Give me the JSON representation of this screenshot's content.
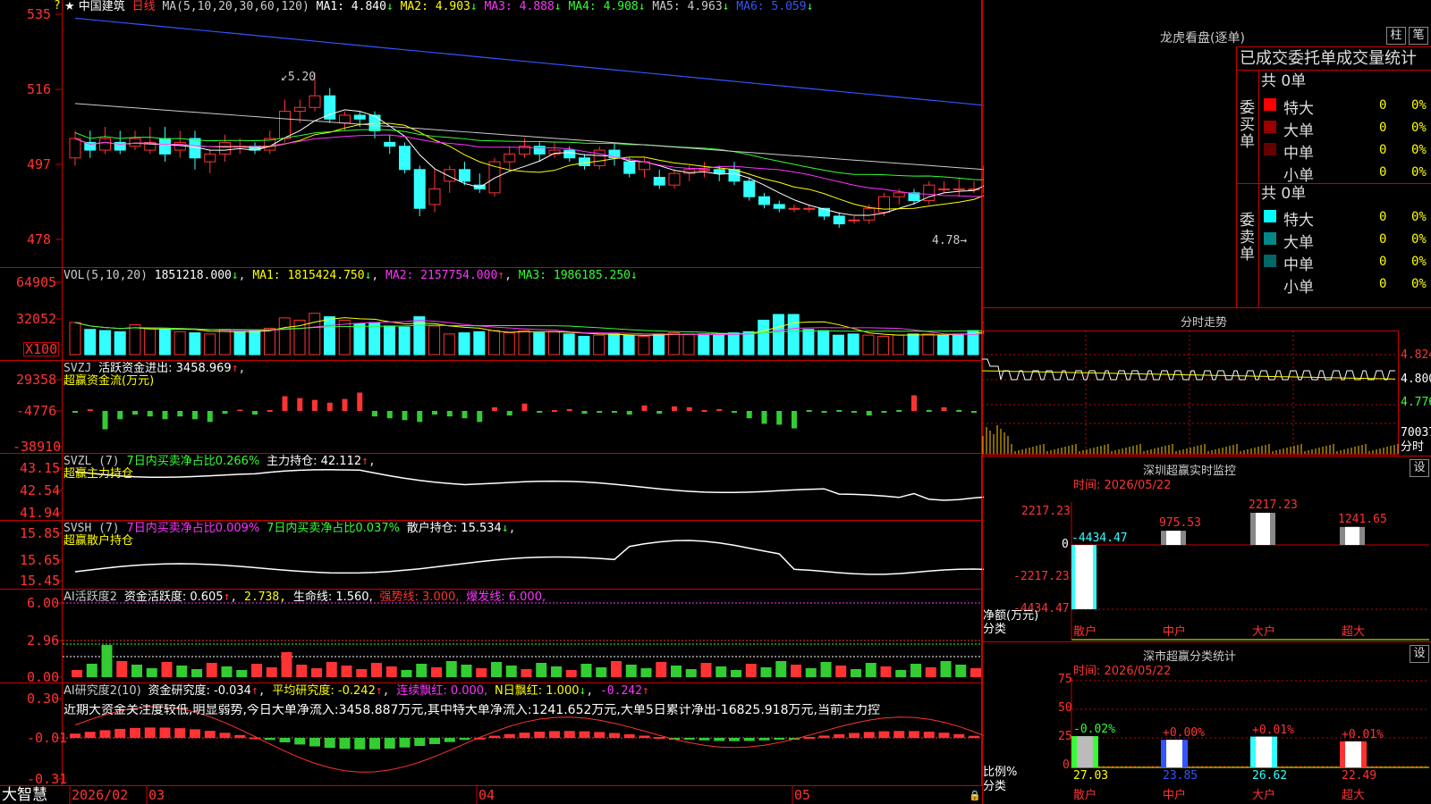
{
  "stock": {
    "title": "★ 中国建筑",
    "period": "日线",
    "ma_header": "MA(5,10,20,30,60,120)",
    "ma_values": [
      {
        "label": "MA1: 4.840",
        "arrow": "↓",
        "color": "#ffffff"
      },
      {
        "label": "MA2: 4.903",
        "arrow": "↓",
        "color": "#ffff00"
      },
      {
        "label": "MA3: 4.888",
        "arrow": "↓",
        "color": "#ff33ff"
      },
      {
        "label": "MA4: 4.908",
        "arrow": "↓",
        "color": "#33ff33"
      },
      {
        "label": "MA5: 4.963",
        "arrow": "↓",
        "color": "#cccccc"
      },
      {
        "label": "MA6: 5.059",
        "arrow": "↓",
        "color": "#3355ff"
      }
    ],
    "y_axis": [
      "535",
      "516",
      "497",
      "478"
    ],
    "high_label": "5.20",
    "low_label": "4.78",
    "question_mark": "?"
  },
  "vol": {
    "header": "VOL(5,10,20)",
    "value": "1851218.000",
    "ma1": "MA1: 1815424.750",
    "ma2": "MA2: 2157754.000",
    "ma3": "MA3: 1986185.250",
    "y_axis": [
      "64905",
      "32052",
      "X100"
    ]
  },
  "svzj": {
    "header": "SVZJ",
    "label": "活跃资金进出: 3458.969",
    "sub": "超赢资金流(万元)",
    "y_axis": [
      "29358",
      "-4776",
      "-38910"
    ]
  },
  "svzl": {
    "header": "SVZL (7)",
    "ratio": "7日内买卖净占比0.266%",
    "hold": "主力持仓: 42.112",
    "sub": "超赢主力持仓",
    "y_axis": [
      "43.15",
      "42.54",
      "41.94"
    ]
  },
  "svsh": {
    "header": "SVSH (7)",
    "ratio1": "7日内买卖净占比0.009%",
    "ratio2": "7日内买卖净占比0.037%",
    "hold": "散户持仓: 15.534",
    "sub": "超赢散户持仓",
    "y_axis": [
      "15.85",
      "15.65",
      "15.45"
    ]
  },
  "ai_active": {
    "header": "AI活跃度2",
    "label": "资金活跃度: 0.605",
    "v2": "2.738,",
    "life": "生命线: 1.560,",
    "strong": "强势线: 3.000,",
    "burst": "爆发线: 6.000,",
    "y_axis": [
      "6.00",
      "2.96",
      "0.00"
    ]
  },
  "ai_research": {
    "header": "AI研究度2(10)",
    "label": "资金研究度: -0.034",
    "avg": "平均研究度: -0.242",
    "cont": "连续飘红: 0.000,",
    "n": "N日飘红: 1.000",
    "last": "-0.242",
    "note": "近期大资金关注度较低,明显弱势,今日大单净流入:3458.887万元,其中特大单净流入:1241.652万元,大单5日累计净出-16825.918万元,当前主力控",
    "y_axis": [
      "0.30",
      "-0.01",
      "-0.31"
    ]
  },
  "bottom_axis": {
    "brand": "大智慧",
    "labels": [
      "2026/02",
      "03",
      "04",
      "05"
    ]
  },
  "longhu": {
    "title": "龙虎看盘(逐单)",
    "btn1": "柱",
    "btn2": "笔",
    "subtitle": "已成交委托单成交量统计",
    "buy_total": "共 0单",
    "buy_label": "委买单",
    "sell_total": "共 0单",
    "sell_label": "委卖单",
    "buy_rows": [
      {
        "label": "特大",
        "num": "0",
        "pct": "0%",
        "color": "#ff0000"
      },
      {
        "label": "大单",
        "num": "0",
        "pct": "0%",
        "color": "#990000"
      },
      {
        "label": "中单",
        "num": "0",
        "pct": "0%",
        "color": "#660000"
      },
      {
        "label": "小单",
        "num": "0",
        "pct": "0%",
        "color": "#000000"
      }
    ],
    "sell_rows": [
      {
        "label": "特大",
        "num": "0",
        "pct": "0%",
        "color": "#00ffff"
      },
      {
        "label": "大单",
        "num": "0",
        "pct": "0%",
        "color": "#008888"
      },
      {
        "label": "中单",
        "num": "0",
        "pct": "0%",
        "color": "#006666"
      },
      {
        "label": "小单",
        "num": "0",
        "pct": "0%",
        "color": "#000000"
      }
    ]
  },
  "intraday": {
    "title": "分时走势",
    "y_axis": [
      "4.824",
      "4.800",
      "4.776"
    ],
    "vol_label": "70037",
    "sub": "分时"
  },
  "monitor": {
    "title": "深圳超赢实时监控",
    "btn": "设",
    "time": "时间: 2026/05/22",
    "y_axis": [
      "2217.23",
      "0",
      "-2217.23",
      "-4434.47"
    ],
    "left_label1": "净额(万元)",
    "left_label2": "分类",
    "bars": [
      {
        "cat": "散户",
        "value": "-4434.47"
      },
      {
        "cat": "中户",
        "value": "975.53"
      },
      {
        "cat": "大户",
        "value": "2217.23"
      },
      {
        "cat": "超大",
        "value": "1241.65"
      }
    ]
  },
  "classify": {
    "title": "深市超赢分类统计",
    "btn": "设",
    "time": "时间: 2026/05/22",
    "y_axis": [
      "75",
      "50",
      "25",
      "0"
    ],
    "left_label1": "比例%",
    "left_label2": "分类",
    "bars": [
      {
        "cat": "散户",
        "pct": "27.03",
        "chg": "-0.02%",
        "color": "#33ff33"
      },
      {
        "cat": "中户",
        "pct": "23.85",
        "chg": "+0.00%",
        "color": "#3355ff"
      },
      {
        "cat": "大户",
        "pct": "26.62",
        "chg": "+0.01%",
        "color": "#33ffff"
      },
      {
        "cat": "超大",
        "pct": "22.49",
        "chg": "+0.01%",
        "color": "#ff3333"
      }
    ]
  },
  "chart_data": [
    {
      "type": "candlestick",
      "title": "中国建筑 日线",
      "ylim": [
        4.75,
        5.38
      ],
      "candles": [
        [
          4.98,
          5.03,
          5.05,
          4.96
        ],
        [
          5.02,
          5.0,
          5.05,
          4.98
        ],
        [
          5.0,
          5.03,
          5.06,
          4.99
        ],
        [
          5.02,
          5.0,
          5.05,
          4.99
        ],
        [
          5.01,
          5.03,
          5.05,
          5.0
        ],
        [
          5.0,
          5.02,
          5.06,
          4.99
        ],
        [
          5.03,
          4.99,
          5.06,
          4.97
        ],
        [
          5.0,
          5.02,
          5.05,
          4.98
        ],
        [
          5.03,
          4.98,
          5.05,
          4.95
        ],
        [
          4.97,
          4.99,
          5.0,
          4.94
        ],
        [
          4.99,
          5.02,
          5.04,
          4.97
        ],
        [
          5.01,
          5.01,
          5.03,
          4.99
        ],
        [
          5.01,
          5.0,
          5.02,
          4.99
        ],
        [
          5.0,
          5.03,
          5.05,
          4.99
        ],
        [
          5.03,
          5.1,
          5.13,
          5.02
        ],
        [
          5.1,
          5.11,
          5.13,
          5.07
        ],
        [
          5.11,
          5.14,
          5.2,
          5.1
        ],
        [
          5.14,
          5.08,
          5.16,
          5.07
        ],
        [
          5.07,
          5.09,
          5.1,
          5.05
        ],
        [
          5.09,
          5.08,
          5.1,
          5.06
        ],
        [
          5.09,
          5.05,
          5.1,
          5.03
        ],
        [
          5.02,
          5.01,
          5.04,
          4.99
        ],
        [
          5.01,
          4.95,
          5.02,
          4.94
        ],
        [
          4.95,
          4.85,
          4.96,
          4.83
        ],
        [
          4.86,
          4.9,
          4.95,
          4.84
        ],
        [
          4.92,
          4.95,
          4.96,
          4.89
        ],
        [
          4.95,
          4.92,
          4.97,
          4.91
        ],
        [
          4.91,
          4.9,
          4.94,
          4.89
        ],
        [
          4.89,
          4.97,
          4.98,
          4.88
        ],
        [
          4.97,
          4.99,
          5.01,
          4.95
        ],
        [
          4.99,
          5.01,
          5.03,
          4.98
        ],
        [
          5.01,
          4.99,
          5.02,
          4.97
        ],
        [
          4.99,
          5.0,
          5.02,
          4.98
        ],
        [
          5.0,
          4.98,
          5.01,
          4.97
        ],
        [
          4.98,
          4.96,
          4.99,
          4.95
        ],
        [
          4.96,
          5.0,
          5.01,
          4.95
        ],
        [
          5.0,
          4.98,
          5.02,
          4.96
        ],
        [
          4.97,
          4.94,
          4.98,
          4.93
        ],
        [
          4.95,
          4.97,
          4.98,
          4.93
        ],
        [
          4.93,
          4.91,
          4.95,
          4.9
        ],
        [
          4.91,
          4.94,
          4.95,
          4.9
        ],
        [
          4.94,
          4.95,
          4.96,
          4.92
        ],
        [
          4.95,
          4.95,
          4.97,
          4.93
        ],
        [
          4.95,
          4.94,
          4.96,
          4.92
        ],
        [
          4.95,
          4.92,
          4.97,
          4.91
        ],
        [
          4.92,
          4.88,
          4.93,
          4.87
        ],
        [
          4.88,
          4.86,
          4.89,
          4.85
        ],
        [
          4.86,
          4.85,
          4.87,
          4.84
        ],
        [
          4.85,
          4.85,
          4.86,
          4.84
        ],
        [
          4.85,
          4.85,
          4.86,
          4.84
        ],
        [
          4.85,
          4.83,
          4.85,
          4.82
        ],
        [
          4.83,
          4.81,
          4.84,
          4.8
        ],
        [
          4.82,
          4.82,
          4.83,
          4.81
        ],
        [
          4.82,
          4.85,
          4.86,
          4.81
        ],
        [
          4.84,
          4.88,
          4.89,
          4.83
        ],
        [
          4.88,
          4.89,
          4.9,
          4.86
        ],
        [
          4.89,
          4.87,
          4.9,
          4.86
        ],
        [
          4.87,
          4.91,
          4.92,
          4.86
        ],
        [
          4.9,
          4.9,
          4.92,
          4.89
        ],
        [
          4.9,
          4.9,
          4.93,
          4.88
        ],
        [
          4.9,
          4.9,
          4.92,
          4.89
        ],
        [
          4.89,
          4.96,
          4.97,
          4.88
        ],
        [
          4.96,
          4.92,
          5.02,
          4.91
        ],
        [
          4.97,
          4.99,
          5.0,
          4.94
        ],
        [
          4.97,
          4.94,
          4.99,
          4.93
        ],
        [
          4.94,
          4.93,
          4.96,
          4.92
        ],
        [
          4.95,
          4.93,
          4.96,
          4.91
        ],
        [
          4.93,
          4.89,
          4.95,
          4.88
        ],
        [
          4.9,
          4.87,
          4.92,
          4.86
        ],
        [
          4.87,
          4.82,
          4.88,
          4.81
        ],
        [
          4.82,
          4.8,
          4.83,
          4.79
        ],
        [
          4.8,
          4.78,
          4.81,
          4.78
        ]
      ],
      "ma_series": [
        {
          "name": "MA1",
          "color": "#ffffff"
        },
        {
          "name": "MA2",
          "color": "#ffff00"
        },
        {
          "name": "MA3",
          "color": "#ff33ff"
        },
        {
          "name": "MA4",
          "color": "#33ff33"
        },
        {
          "name": "MA5",
          "color": "#cccccc"
        },
        {
          "name": "MA6",
          "color": "#3355ff"
        }
      ]
    },
    {
      "type": "bar",
      "title": "VOL",
      "ylim": [
        0,
        70000
      ],
      "values": [
        28000,
        22000,
        21000,
        20000,
        26000,
        23000,
        22000,
        20000,
        19000,
        18000,
        22000,
        20000,
        21000,
        23000,
        32000,
        30000,
        36000,
        33000,
        30000,
        27000,
        28000,
        25000,
        24000,
        33000,
        25000,
        18000,
        19000,
        20000,
        21000,
        19000,
        21000,
        19000,
        20000,
        18000,
        16000,
        17000,
        18000,
        17000,
        16000,
        18000,
        19000,
        18000,
        18000,
        17000,
        19000,
        20000,
        30000,
        35000,
        35000,
        22000,
        21000,
        17000,
        18000,
        17000,
        16000,
        17000,
        18000,
        18000,
        17000,
        18000,
        21000,
        28000,
        30000,
        27000,
        25000,
        24000,
        23000,
        22000,
        19000,
        21000,
        20000,
        18000
      ],
      "up": [
        1,
        0,
        0,
        0,
        1,
        1,
        0,
        1,
        0,
        1,
        1,
        0,
        0,
        1,
        1,
        1,
        1,
        0,
        1,
        0,
        0,
        0,
        0,
        0,
        1,
        1,
        0,
        0,
        1,
        1,
        1,
        0,
        1,
        0,
        0,
        1,
        0,
        0,
        1,
        0,
        1,
        1,
        0,
        0,
        0,
        0,
        0,
        0,
        0,
        0,
        0,
        0,
        0,
        1,
        1,
        1,
        0,
        1,
        0,
        0,
        0,
        1,
        1,
        1,
        0,
        0,
        0,
        0,
        0,
        0,
        0,
        0
      ]
    },
    {
      "type": "bar",
      "title": "超赢资金流(万元)",
      "ylim": [
        -38910,
        29358
      ],
      "values": [
        -2000,
        1800,
        -20000,
        -9000,
        -4000,
        -6000,
        -9000,
        -6000,
        -9000,
        -12000,
        -3000,
        1500,
        -4000,
        1200,
        16000,
        14000,
        12000,
        9000,
        13000,
        20000,
        -6000,
        -8000,
        -10000,
        -12000,
        -4000,
        -6000,
        -8000,
        -12000,
        4000,
        -5000,
        8000,
        -2000,
        1000,
        2000,
        -3000,
        -2000,
        -2000,
        -4000,
        6000,
        -3000,
        5000,
        4000,
        1000,
        2000,
        -2000,
        -8000,
        -14000,
        -15000,
        -19000,
        -1000,
        -2000,
        -1000,
        -2000,
        -5000,
        -2000,
        -1000,
        17000,
        -1000,
        4000,
        -1000,
        -2000,
        -1000,
        -4000,
        6000,
        -20000,
        -14000,
        -1000,
        -2000,
        -3000,
        -3000,
        -1000,
        -1000,
        -2000,
        -1000,
        -1000,
        -2000,
        -1000,
        -3000,
        -1000,
        -2000,
        -1000,
        -1000
      ]
    }
  ]
}
